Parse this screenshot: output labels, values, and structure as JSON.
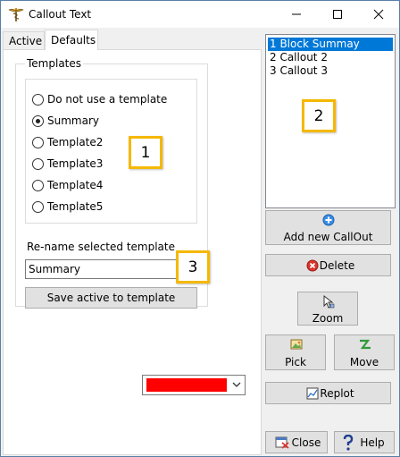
{
  "window": {
    "title": "Callout Text"
  },
  "tabs": [
    {
      "label": "Active"
    },
    {
      "label": "Defaults"
    }
  ],
  "templates": {
    "legend": "Templates",
    "options": [
      {
        "label": "Do not use a template",
        "checked": false
      },
      {
        "label": "Summary",
        "checked": true
      },
      {
        "label": "Template2",
        "checked": false
      },
      {
        "label": "Template3",
        "checked": false
      },
      {
        "label": "Template4",
        "checked": false
      },
      {
        "label": "Template5",
        "checked": false
      }
    ],
    "rename_label": "Re-name selected template",
    "rename_value": "Summary",
    "save_label": "Save active to template"
  },
  "color_dropdown": {
    "selected_color": "#ff0000"
  },
  "callouts": {
    "items": [
      {
        "label": "1  Block Summay",
        "selected": true
      },
      {
        "label": "2  Callout 2",
        "selected": false
      },
      {
        "label": "3  Callout 3",
        "selected": false
      }
    ]
  },
  "buttons": {
    "add_new": "Add new CallOut",
    "delete": "Delete",
    "zoom": "Zoom",
    "pick": "Pick",
    "move": "Move",
    "replot": "Replot",
    "close": "Close",
    "help": "Help"
  },
  "badges": {
    "b1": "1",
    "b2": "2",
    "b3": "3"
  },
  "colors": {
    "badge_border": "#f5b800",
    "selection": "#0078d7",
    "add_icon": "#3a8ee6",
    "delete_icon": "#d9342b",
    "move_icon": "#2e9a3a"
  }
}
